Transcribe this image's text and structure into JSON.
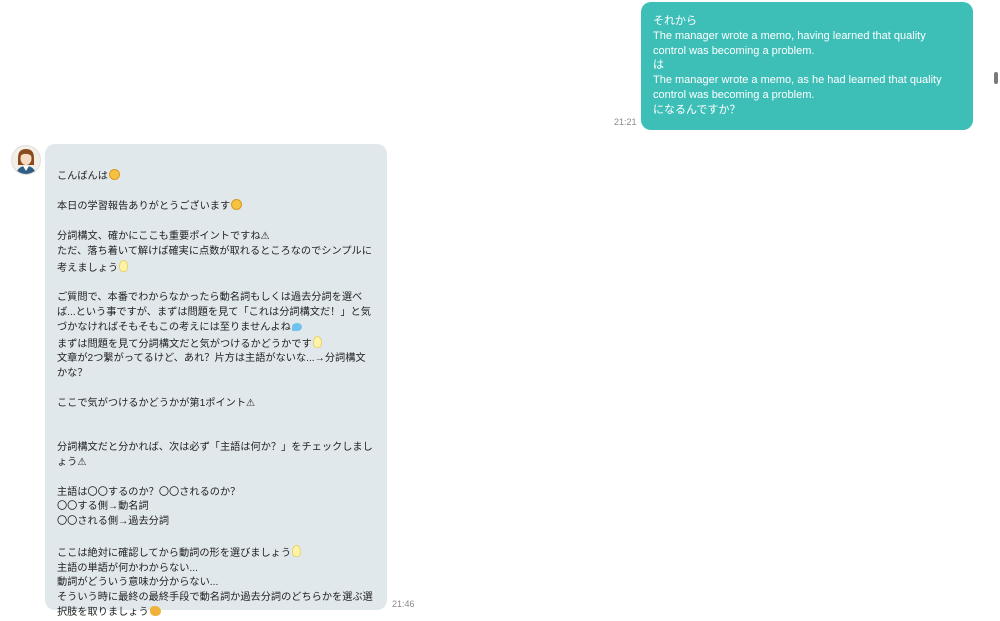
{
  "messages": {
    "outgoing": {
      "text": "それから\nThe manager wrote a memo, having learned that quality control was becoming a problem.\nは\nThe manager wrote a memo, as he had learned that quality control was becoming a problem.\nになるんですか？",
      "time": "21:21"
    },
    "incoming": {
      "avatar_icon": "teacher-avatar",
      "time": "21:46",
      "lines": [
        "こんばんは",
        "",
        "本日の学習報告ありがとうございます",
        "",
        "分詞構文、確かにここも重要ポイントですね⚠",
        "ただ、落ち着いて解けば確実に点数が取れるところなのでシンプルに考えましょう",
        "",
        "ご質問で、本番でわからなかったら動名詞もしくは過去分詞を選べば...という事ですが、まずは問題を見て「これは分詞構文だ！」と気づかなければそもそもこの考えには至りませんよね",
        "まずは問題を見て分詞構文だと気がつけるかどうかです",
        "文章が2つ繋がってるけど、あれ？片方は主語がないな...→分詞構文かな？",
        "",
        "ここで気がつけるかどうかが第1ポイント⚠",
        "",
        "",
        "分詞構文だと分かれば、次は必ず「主語は何か？」をチェックしましょう⚠",
        "",
        "主語は〇〇するのか？〇〇されるのか？",
        "〇〇する側→動名詞",
        "〇〇される側→過去分詞",
        "",
        "ここは絶対に確認してから動詞の形を選びましょう",
        "主語の単語が何かわからない...",
        "動詞がどういう意味か分からない...",
        "そういう時に最終の最終手段で動名詞か過去分詞のどちらかを選ぶ選択肢を取りましょう"
      ]
    }
  },
  "colors": {
    "outgoing_bubble": "#3dbfb8",
    "incoming_bubble": "#e1e8ec"
  }
}
